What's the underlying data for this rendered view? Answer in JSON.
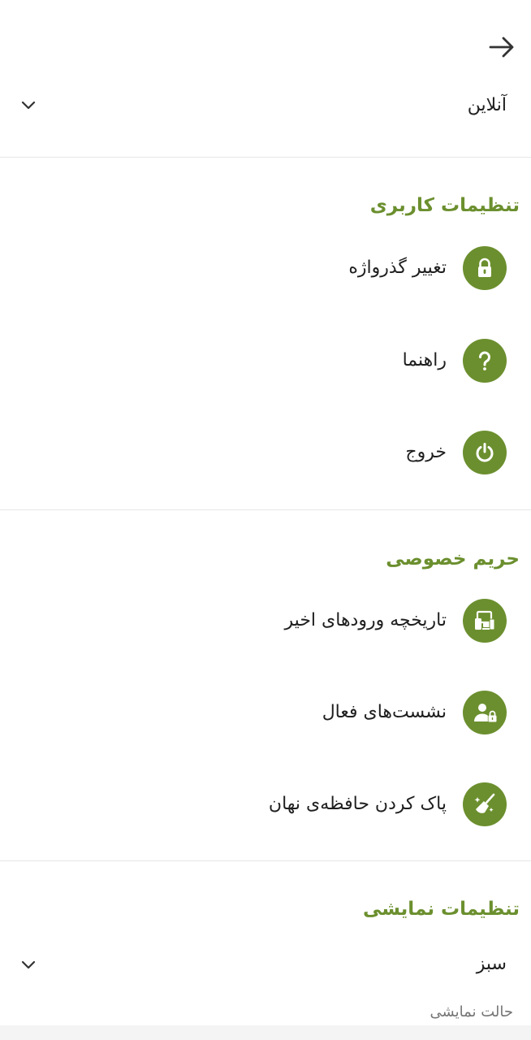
{
  "header": {
    "back_icon": "arrow-right-icon"
  },
  "status_select": {
    "value": "آنلاین",
    "icon": "chevron-down-icon"
  },
  "sections": {
    "user_settings": {
      "title": "تنظیمات کاربری",
      "items": [
        {
          "label": "تغییر گذرواژه",
          "icon": "lock-icon"
        },
        {
          "label": "راهنما",
          "icon": "help-icon"
        },
        {
          "label": "خروج",
          "icon": "power-icon"
        }
      ]
    },
    "privacy": {
      "title": "حریم خصوصی",
      "items": [
        {
          "label": "تاریخچه ورودهای اخیر",
          "icon": "devices-icon"
        },
        {
          "label": "نشست‌های فعال",
          "icon": "user-lock-icon"
        },
        {
          "label": "پاک کردن حافظه‌ی نهان",
          "icon": "broom-icon"
        }
      ]
    },
    "display": {
      "title": "تنظیمات نمایشی",
      "theme_select": {
        "value": "سبز",
        "helper": "حالت نمایشی",
        "icon": "chevron-down-icon"
      }
    }
  },
  "colors": {
    "accent": "#6b8f2e",
    "text": "#1f1f1f",
    "helper_text": "#757575",
    "divider": "#e6e6e6"
  }
}
